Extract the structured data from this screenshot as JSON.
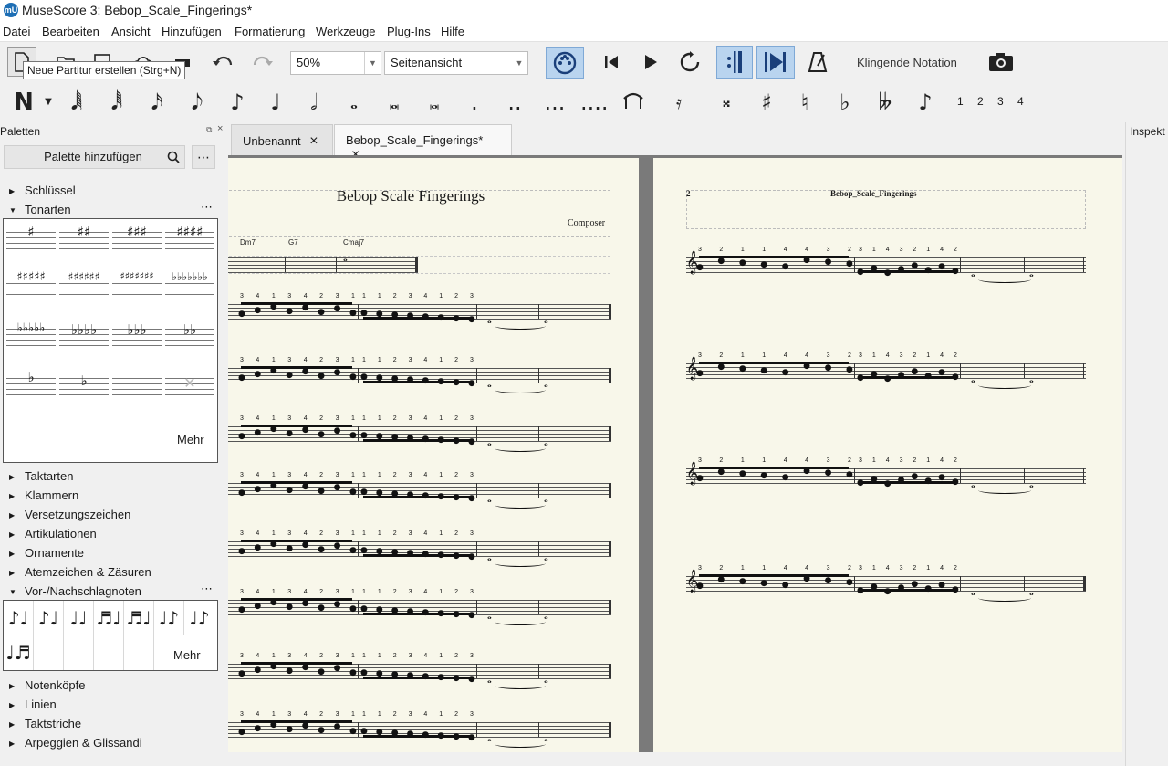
{
  "window": {
    "title": "MuseScore 3: Bebop_Scale_Fingerings*",
    "logo": "mU"
  },
  "menu": [
    "Datei",
    "Bearbeiten",
    "Ansicht",
    "Hinzufügen",
    "Formatierung",
    "Werkzeuge",
    "Plug-Ins",
    "Hilfe"
  ],
  "toolbar": {
    "zoom": "50%",
    "view_mode": "Seitenansicht",
    "concert_pitch": "Klingende Notation",
    "tooltip": "Neue Partitur erstellen (Strg+N)"
  },
  "note_toolbar": {
    "voices": [
      "1",
      "2",
      "3",
      "4"
    ]
  },
  "palettes": {
    "title": "Paletten",
    "add_button": "Palette hinzufügen",
    "more_glyph": "⋯",
    "items_top": [
      "Schlüssel",
      "Tonarten"
    ],
    "keysig_more": "Mehr",
    "items_mid": [
      "Taktarten",
      "Klammern",
      "Versetzungszeichen",
      "Artikulationen",
      "Ornamente",
      "Atemzeichen & Zäsuren",
      "Vor-/Nachschlagnoten"
    ],
    "grace_more": "Mehr",
    "items_bottom": [
      "Notenköpfe",
      "Linien",
      "Taktstriche",
      "Arpeggien & Glissandi"
    ]
  },
  "tabs": [
    {
      "label": "Unbenannt",
      "close": "×"
    },
    {
      "label": "Bebop_Scale_Fingerings*",
      "close": "×"
    }
  ],
  "inspector": {
    "title": "Inspekt"
  },
  "score": {
    "page1": {
      "title": "Bebop Scale Fingerings",
      "composer": "Composer",
      "chords": [
        "Dm7",
        "G7",
        "Cmaj7"
      ]
    },
    "page2": {
      "page_number": "2",
      "header": "Bebop_Scale_Fingerings"
    }
  },
  "colors": {
    "accent": "#2a7fd4",
    "paper": "#f8f7ea",
    "selected_button": "#b9d4ef"
  }
}
